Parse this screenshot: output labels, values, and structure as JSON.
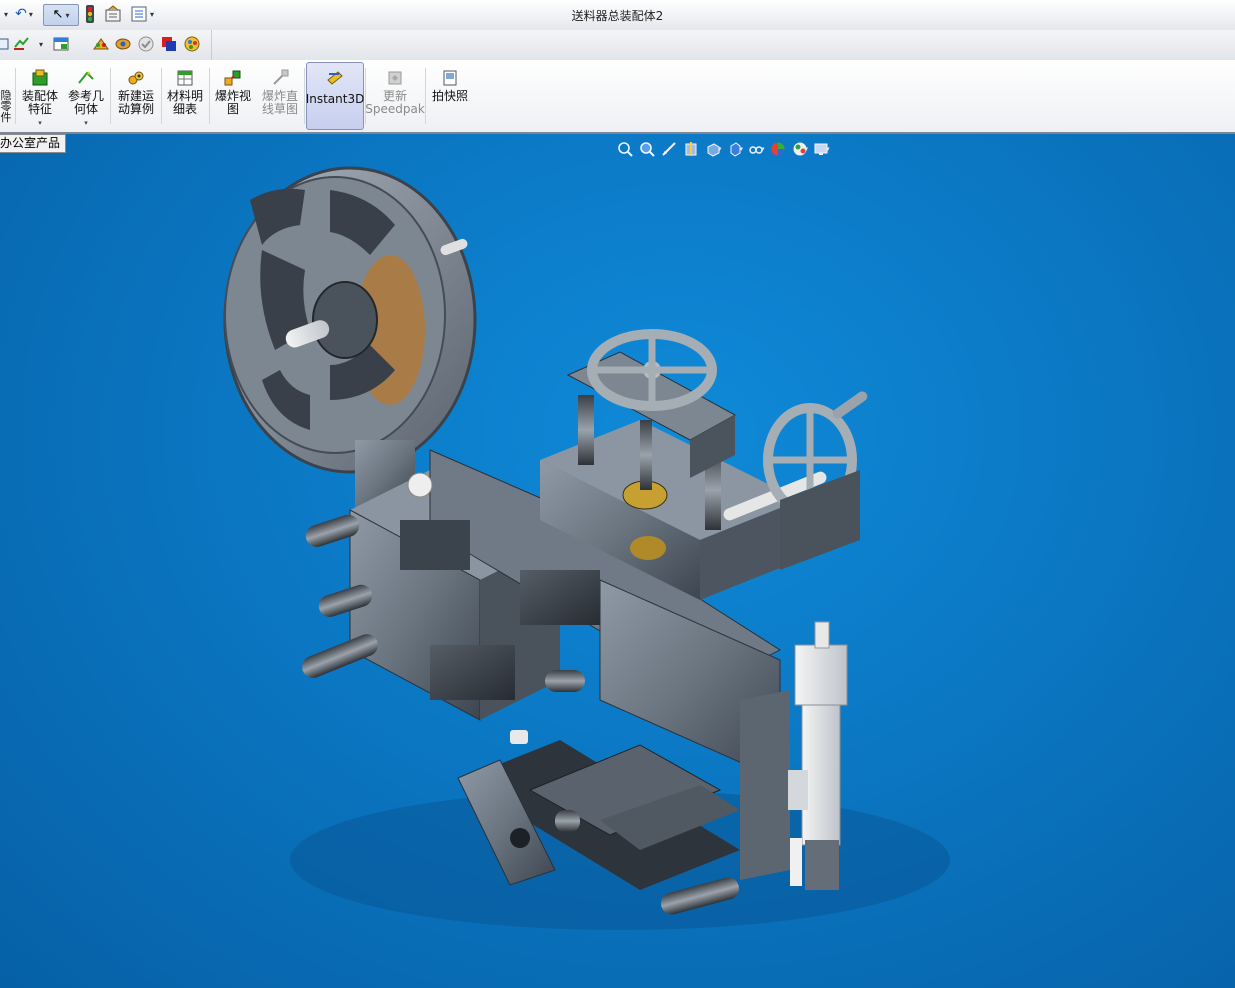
{
  "window": {
    "title": "送料器总装配体2"
  },
  "quick_access": {
    "undo_icon": "undo-icon",
    "select_icon": "select-arrow-icon",
    "traffic_light_icon": "rebuild-status-icon",
    "options_icon": "options-icon",
    "customize_icon": "customize-icon"
  },
  "ribbon": {
    "partial_left_label": "隐\n零\n件",
    "commands": [
      {
        "id": "assembly-feature",
        "label": "装配体\n特征",
        "has_dropdown": true,
        "enabled": true
      },
      {
        "id": "reference-geometry",
        "label": "参考几\n何体",
        "has_dropdown": true,
        "enabled": true
      },
      {
        "id": "new-motion-study",
        "label": "新建运\n动算例",
        "has_dropdown": false,
        "enabled": true
      },
      {
        "id": "bill-of-materials",
        "label": "材料明\n细表",
        "has_dropdown": false,
        "enabled": true
      },
      {
        "id": "exploded-view",
        "label": "爆炸视\n图",
        "has_dropdown": false,
        "enabled": true
      },
      {
        "id": "explode-line-sketch",
        "label": "爆炸直\n线草图",
        "has_dropdown": false,
        "enabled": false
      },
      {
        "id": "instant3d",
        "label": "Instant3D",
        "has_dropdown": false,
        "enabled": true,
        "active": true
      },
      {
        "id": "update-speedpak",
        "label": "更新\nSpeedpak",
        "has_dropdown": false,
        "enabled": false
      },
      {
        "id": "take-snapshot",
        "label": "拍快照",
        "has_dropdown": false,
        "enabled": true
      }
    ]
  },
  "tab": {
    "label": "办公室产品"
  },
  "colors": {
    "viewport_bg": "#0a76c2",
    "metal": "#6f7a86",
    "ribbon_active": "#c7cfee"
  }
}
